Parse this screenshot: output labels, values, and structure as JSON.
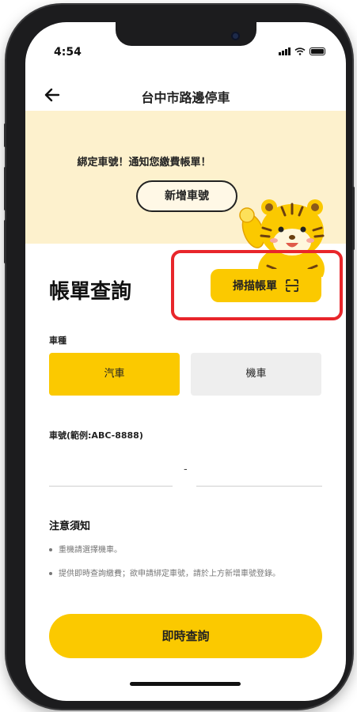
{
  "status_bar": {
    "time": "4:54"
  },
  "header": {
    "title": "台中市路邊停車"
  },
  "banner": {
    "text": "綁定車號！通知您繳費帳單！",
    "add_button": "新增車號"
  },
  "bill": {
    "title": "帳單查詢",
    "scan_button": "掃描帳單"
  },
  "vehicle_type": {
    "label": "車種",
    "options": [
      "汽車",
      "機車"
    ],
    "selected": "汽車"
  },
  "plate": {
    "label": "車號(範例:ABC-8888)",
    "separator": "-",
    "part1": "",
    "part2": ""
  },
  "notice": {
    "title": "注意須知",
    "items": [
      "重機請選擇機車。",
      "提供即時查詢繳費；欲申請綁定車號，請於上方新增車號登錄。"
    ]
  },
  "submit": {
    "label": "即時查詢"
  },
  "colors": {
    "accent": "#fbc900",
    "banner_bg": "#fdf1cd",
    "highlight": "#e8262b"
  },
  "icons": [
    "back-arrow-icon",
    "scan-icon",
    "signal-icon",
    "wifi-icon",
    "battery-icon"
  ]
}
